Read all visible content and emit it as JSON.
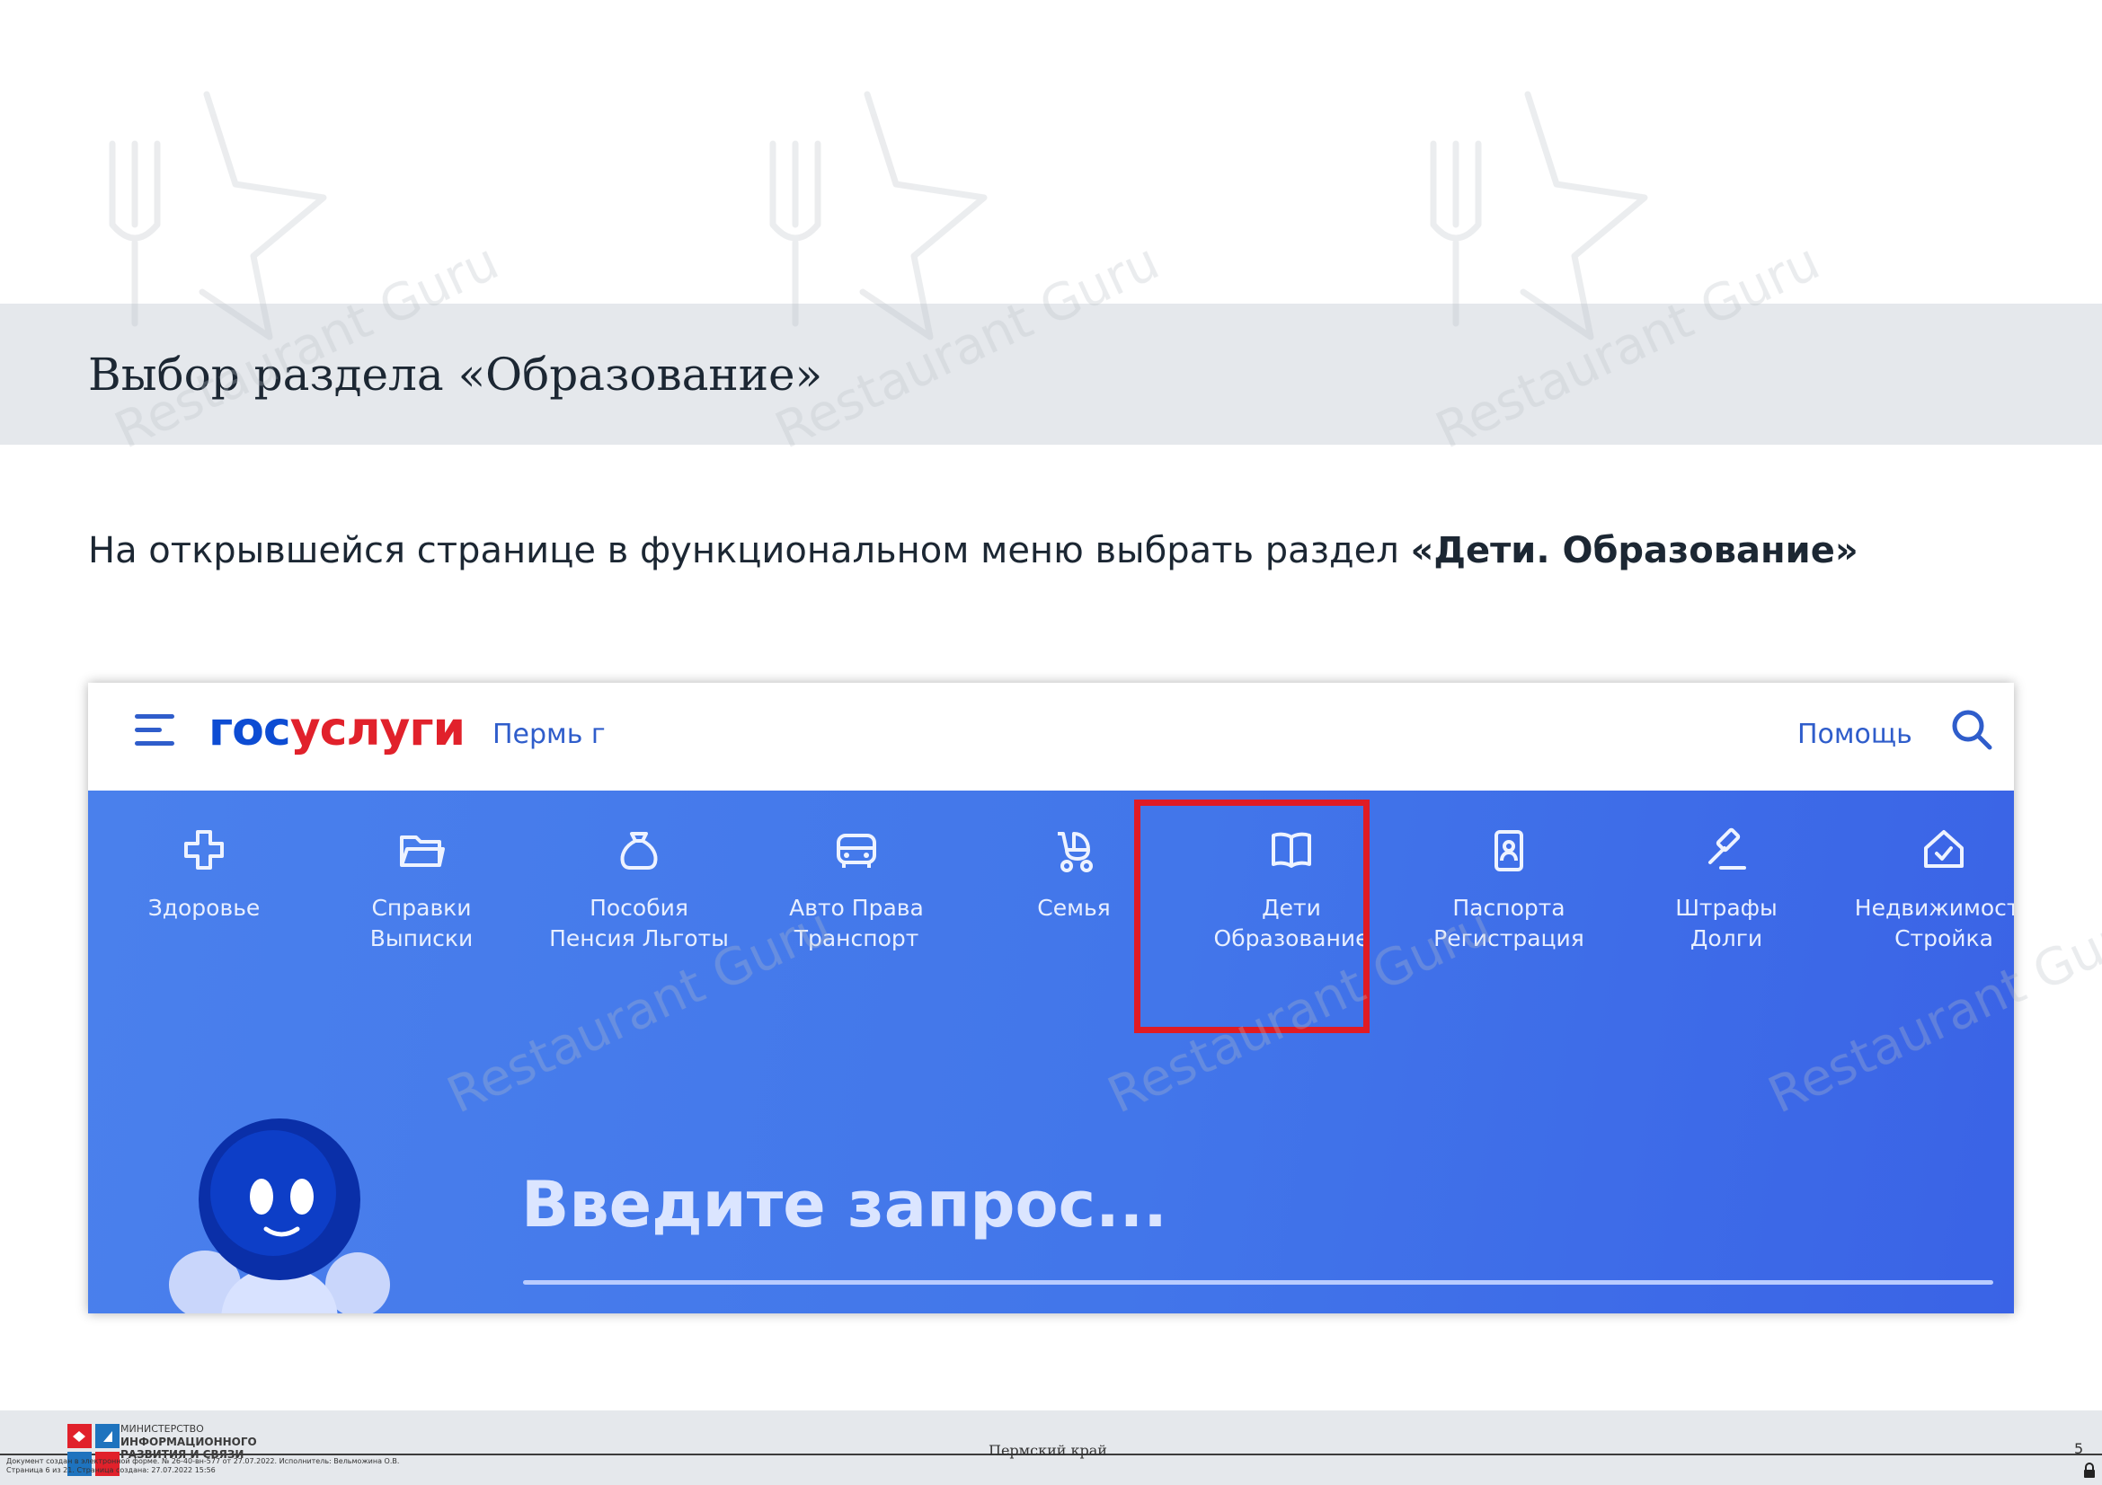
{
  "slide": {
    "title": "Выбор раздела «Образование»",
    "instruction_prefix": "На открывшейся странице в функциональном меню выбрать раздел ",
    "instruction_bold": "«Дети. Образование»"
  },
  "screenshot": {
    "header": {
      "logo_part1": "гос",
      "logo_part2": "услуги",
      "region": "Пермь г",
      "help_label": "Помощь"
    },
    "categories": [
      {
        "line1": "Здоровье",
        "line2": "",
        "icon": "medical-cross-icon"
      },
      {
        "line1": "Справки",
        "line2": "Выписки",
        "icon": "folder-icon"
      },
      {
        "line1": "Пособия",
        "line2": "Пенсия Льготы",
        "icon": "money-bag-icon"
      },
      {
        "line1": "Авто Права",
        "line2": "Транспорт",
        "icon": "car-icon"
      },
      {
        "line1": "Семья",
        "line2": "",
        "icon": "stroller-icon"
      },
      {
        "line1": "Дети",
        "line2": "Образование",
        "icon": "open-book-icon"
      },
      {
        "line1": "Паспорта",
        "line2": "Регистрация",
        "icon": "passport-icon"
      },
      {
        "line1": "Штрафы",
        "line2": "Долги",
        "icon": "gavel-icon"
      },
      {
        "line1": "Недвижимость",
        "line2": "Стройка",
        "icon": "house-check-icon"
      }
    ],
    "search_placeholder": "Введите запрос...",
    "highlight_color": "#e01b24",
    "brand_blue": "#0d4cd3",
    "brand_red": "#e1212b"
  },
  "footer": {
    "ministry_line1": "МИНИСТЕРСТВО",
    "ministry_line2": "ИНФОРМАЦИОННОГО",
    "ministry_line3": "РАЗВИТИЯ И СВЯЗИ",
    "region": "Пермский край",
    "page_number": "5",
    "doc_meta_line1": "Документ создан в электронной форме. № 26-40-вн-577 от 27.07.2022. Исполнитель: Вельможина О.В.",
    "doc_meta_line2": "Страница 6 из 21. Страница создана: 27.07.2022 15:56"
  },
  "watermark": {
    "text": "Restaurant Guru"
  }
}
